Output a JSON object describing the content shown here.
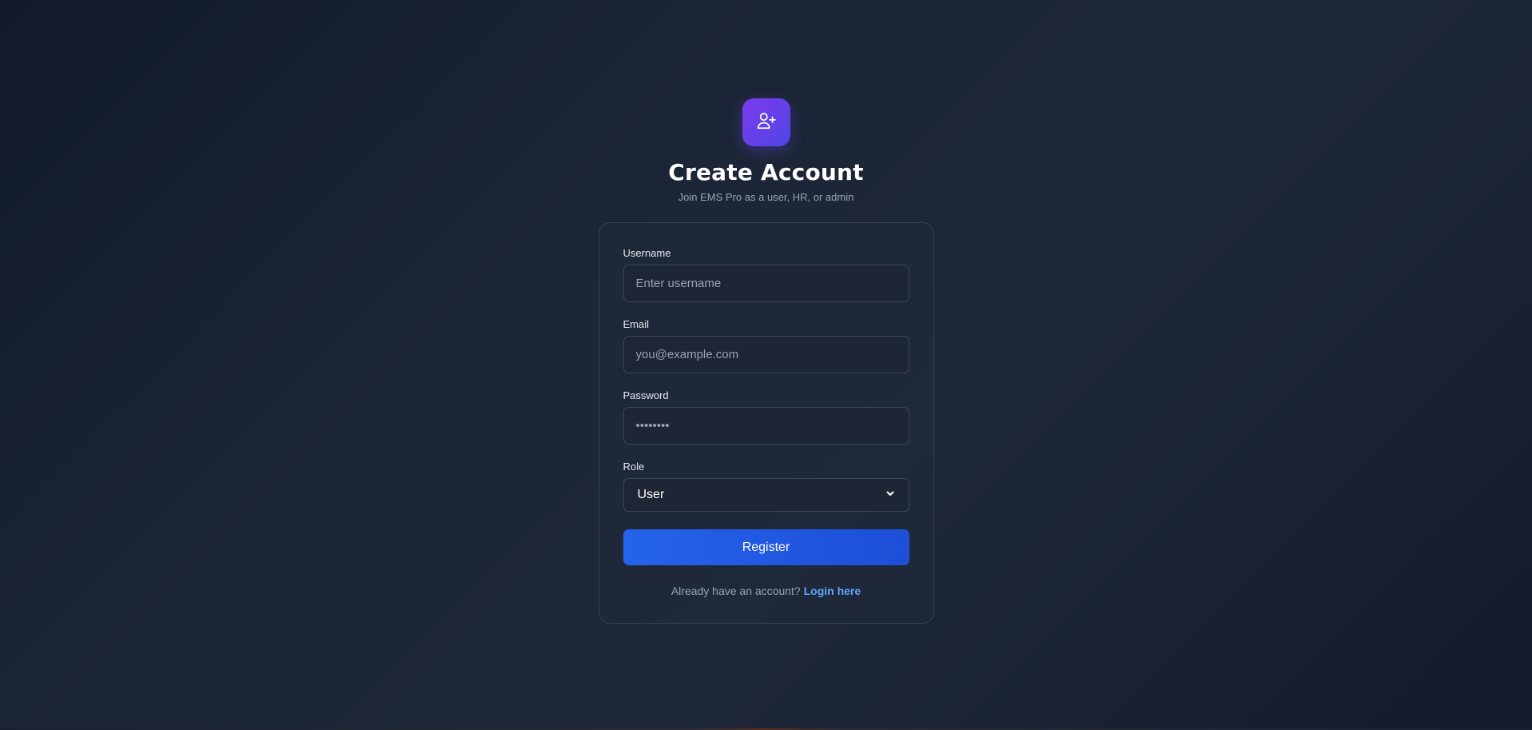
{
  "header": {
    "icon": "user-plus-icon",
    "title": "Create Account",
    "subtitle": "Join EMS Pro as a user, HR, or admin"
  },
  "form": {
    "username": {
      "label": "Username",
      "placeholder": "Enter username",
      "value": ""
    },
    "email": {
      "label": "Email",
      "placeholder": "you@example.com",
      "value": ""
    },
    "password": {
      "label": "Password",
      "placeholder": "••••••••",
      "value": ""
    },
    "role": {
      "label": "Role",
      "selected": "User"
    },
    "submit_label": "Register"
  },
  "footer": {
    "prompt": "Already have an account?",
    "link_text": "Login here"
  },
  "colors": {
    "accent": "#2563eb",
    "link": "#60a5fa",
    "logo_gradient_start": "#7c3aed",
    "logo_gradient_end": "#4f46e5"
  }
}
